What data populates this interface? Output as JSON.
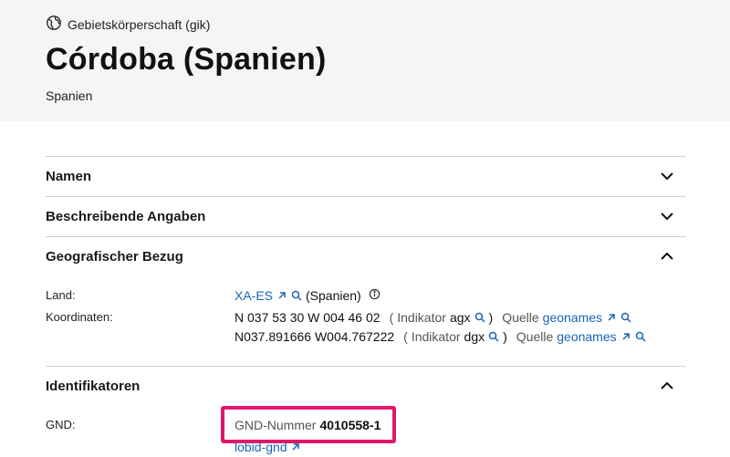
{
  "header": {
    "entity_type": "Gebietskörperschaft (gik)",
    "title": "Córdoba (Spanien)",
    "subtitle": "Spanien"
  },
  "sections": {
    "names": {
      "label": "Namen",
      "expanded": false
    },
    "descriptive": {
      "label": "Beschreibende Angaben",
      "expanded": false
    },
    "geo": {
      "label": "Geografischer Bezug",
      "expanded": true
    },
    "ident": {
      "label": "Identifikatoren",
      "expanded": true
    }
  },
  "geo": {
    "land_label": "Land:",
    "land_code": "XA-ES",
    "land_name": "(Spanien)",
    "coords_label": "Koordinaten:",
    "coord1": {
      "value": "N 037 53 30 W 004 46 02",
      "open": "(",
      "indicator_label": "Indikator",
      "indicator": "agx",
      "close": ")",
      "source_label": "Quelle",
      "source": "geonames"
    },
    "coord2": {
      "value": "N037.891666 W004.767222",
      "open": "(",
      "indicator_label": "Indikator",
      "indicator": "dgx",
      "close": ")",
      "source_label": "Quelle",
      "source": "geonames"
    }
  },
  "ident": {
    "gnd_label": "GND:",
    "gnd_number_label": "GND-Nummer",
    "gnd_number": "4010558-1",
    "lobid_link": "lobid-gnd"
  },
  "colors": {
    "accent_link": "#1a63b5",
    "highlight_box": "#e0176b",
    "header_bg": "#f5f5f5"
  }
}
